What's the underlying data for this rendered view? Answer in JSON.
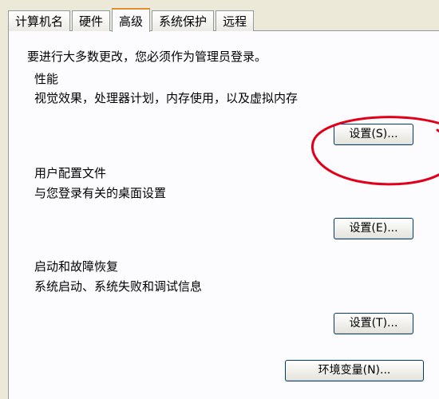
{
  "tabs": [
    {
      "label": "计算机名"
    },
    {
      "label": "硬件"
    },
    {
      "label": "高级"
    },
    {
      "label": "系统保护"
    },
    {
      "label": "远程"
    }
  ],
  "active_tab": "高级",
  "admin_notice": "要进行大多数更改，您必须作为管理员登录。",
  "performance": {
    "title": "性能",
    "description": "视觉效果，处理器计划，内存使用，以及虚拟内存",
    "button_label": "设置(S)..."
  },
  "user_profiles": {
    "title": "用户配置文件",
    "description": "与您登录有关的桌面设置",
    "button_label": "设置(E)..."
  },
  "startup_recovery": {
    "title": "启动和故障恢复",
    "description": "系统启动、系统失败和调试信息",
    "button_label": "设置(T)..."
  },
  "env_vars_button_label": "环境变量(N)...",
  "annotation_color": "#e0001a"
}
